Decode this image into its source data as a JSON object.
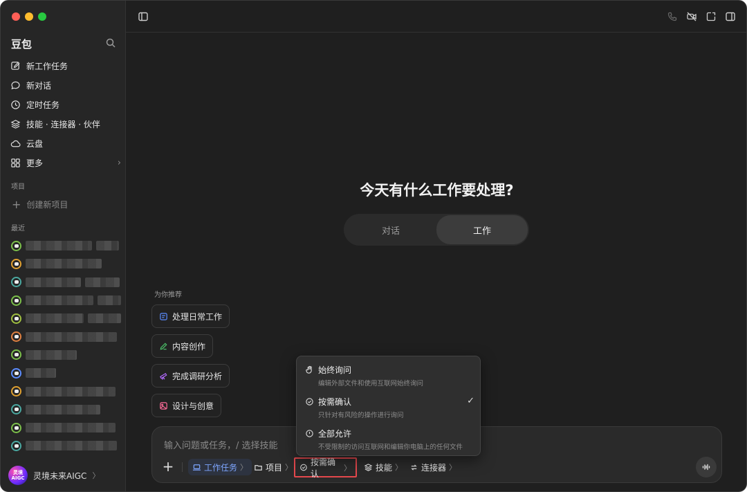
{
  "app": {
    "title": "豆包"
  },
  "sidebar": {
    "nav": [
      {
        "label": "新工作任务",
        "icon": "edit-icon"
      },
      {
        "label": "新对话",
        "icon": "chat-icon"
      },
      {
        "label": "定时任务",
        "icon": "clock-icon"
      },
      {
        "label": "技能 · 连接器 · 伙伴",
        "icon": "layers-icon"
      },
      {
        "label": "云盘",
        "icon": "cloud-icon"
      },
      {
        "label": "更多",
        "icon": "grid-icon"
      }
    ],
    "projects_label": "项目",
    "create_project": "创建新项目",
    "recent_label": "最近",
    "recent_colors": [
      "#7bbf4a",
      "#e0a030",
      "#4aa8a0",
      "#7bbf4a",
      "#a0c040",
      "#e08040",
      "#7bbf4a",
      "#5b8cff",
      "#e0a030",
      "#4aa8a0",
      "#7bbf4a",
      "#4aa8a0"
    ],
    "user": {
      "name": "灵境未来AIGC",
      "avatar_text": "灵境 AIGC"
    }
  },
  "main": {
    "headline": "今天有什么工作要处理?",
    "modes": [
      {
        "label": "对话",
        "active": false
      },
      {
        "label": "工作",
        "active": true
      }
    ],
    "recommend_label": "为你推荐",
    "recommendations": [
      {
        "label": "处理日常工作",
        "icon": "doc-icon",
        "color": "#5b8cff"
      },
      {
        "label": "内容创作",
        "icon": "pen-icon",
        "color": "#4cc26a"
      },
      {
        "label": "完成调研分析",
        "icon": "telescope-icon",
        "color": "#b36bff"
      },
      {
        "label": "设计与创意",
        "icon": "image-icon",
        "color": "#ff6b9a"
      }
    ],
    "composer": {
      "placeholder": "输入问题或任务，/ 选择技能",
      "buttons": {
        "task": "工作任务",
        "project": "项目",
        "confirm": "按需确认",
        "skills": "技能",
        "connectors": "连接器"
      }
    },
    "permission_menu": [
      {
        "title": "始终询问",
        "desc": "编辑外部文件和使用互联网始终询问",
        "icon": "hand-icon",
        "selected": false
      },
      {
        "title": "按需确认",
        "desc": "只针对有风险的操作进行询问",
        "icon": "check-circle-icon",
        "selected": true
      },
      {
        "title": "全部允许",
        "desc": "不受限制的访问互联网和编辑你电脑上的任何文件",
        "icon": "alert-circle-icon",
        "selected": false
      }
    ]
  },
  "colors": {
    "accent": "#7ea6ff",
    "highlight_border": "#e5484d"
  }
}
